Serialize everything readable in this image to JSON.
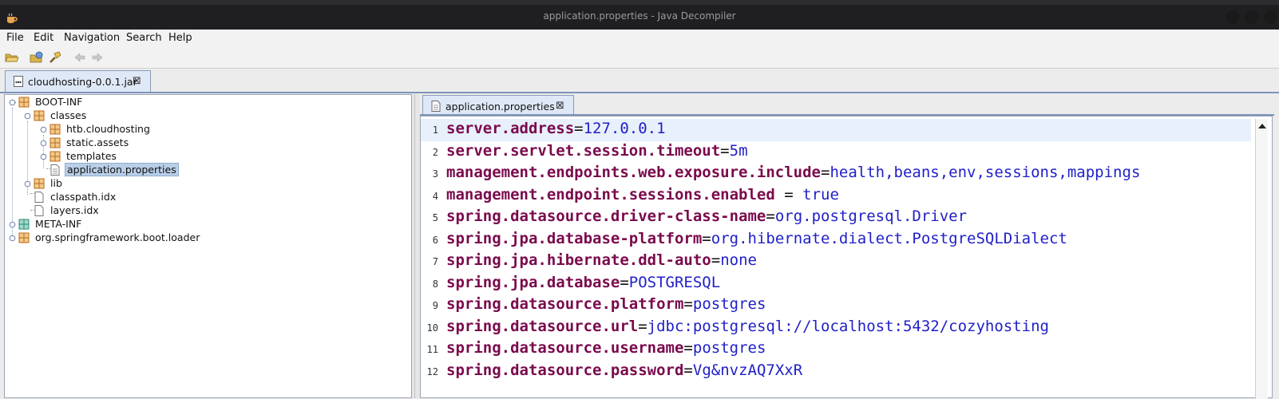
{
  "window": {
    "title": "application.properties - Java Decompiler"
  },
  "menu": [
    "File",
    "Edit",
    "Navigation",
    "Search",
    "Help"
  ],
  "file_tab": {
    "label": "cloudhosting-0.0.1.jar"
  },
  "tree": {
    "nodes": [
      {
        "label": "BOOT-INF",
        "depth": 0,
        "type": "package"
      },
      {
        "label": "classes",
        "depth": 1,
        "type": "package"
      },
      {
        "label": "htb.cloudhosting",
        "depth": 2,
        "type": "package"
      },
      {
        "label": "static.assets",
        "depth": 2,
        "type": "package"
      },
      {
        "label": "templates",
        "depth": 2,
        "type": "package"
      },
      {
        "label": "application.properties",
        "depth": 2,
        "type": "file",
        "selected": true
      },
      {
        "label": "lib",
        "depth": 1,
        "type": "package"
      },
      {
        "label": "classpath.idx",
        "depth": 1,
        "type": "file"
      },
      {
        "label": "layers.idx",
        "depth": 1,
        "type": "file"
      },
      {
        "label": "META-INF",
        "depth": 0,
        "type": "package-green"
      },
      {
        "label": "org.springframework.boot.loader",
        "depth": 0,
        "type": "package"
      }
    ]
  },
  "editor_tab": {
    "label": "application.properties"
  },
  "editor": {
    "lines": [
      {
        "n": "1",
        "key": "server.address",
        "sep": "=",
        "value": "127.0.0.1"
      },
      {
        "n": "2",
        "key": "server.servlet.session.timeout",
        "sep": "=",
        "value": "5m"
      },
      {
        "n": "3",
        "key": "management.endpoints.web.exposure.include",
        "sep": "=",
        "value": "health,beans,env,sessions,mappings"
      },
      {
        "n": "4",
        "key": "management.endpoint.sessions.enabled",
        "sep": " = ",
        "value": "true"
      },
      {
        "n": "5",
        "key": "spring.datasource.driver-class-name",
        "sep": "=",
        "value": "org.postgresql.Driver"
      },
      {
        "n": "6",
        "key": "spring.jpa.database-platform",
        "sep": "=",
        "value": "org.hibernate.dialect.PostgreSQLDialect"
      },
      {
        "n": "7",
        "key": "spring.jpa.hibernate.ddl-auto",
        "sep": "=",
        "value": "none"
      },
      {
        "n": "8",
        "key": "spring.jpa.database",
        "sep": "=",
        "value": "POSTGRESQL"
      },
      {
        "n": "9",
        "key": "spring.datasource.platform",
        "sep": "=",
        "value": "postgres"
      },
      {
        "n": "10",
        "key": "spring.datasource.url",
        "sep": "=",
        "value": "jdbc:postgresql://localhost:5432/cozyhosting"
      },
      {
        "n": "11",
        "key": "spring.datasource.username",
        "sep": "=",
        "value": "postgres"
      },
      {
        "n": "12",
        "key": "spring.datasource.password",
        "sep": "=",
        "value": "Vg&nvzAQ7XxR"
      }
    ]
  },
  "colors": {
    "key": "#7a0a4c",
    "value": "#2020c8",
    "selection": "#b9cfe8",
    "tab": "#dfe8f6"
  }
}
